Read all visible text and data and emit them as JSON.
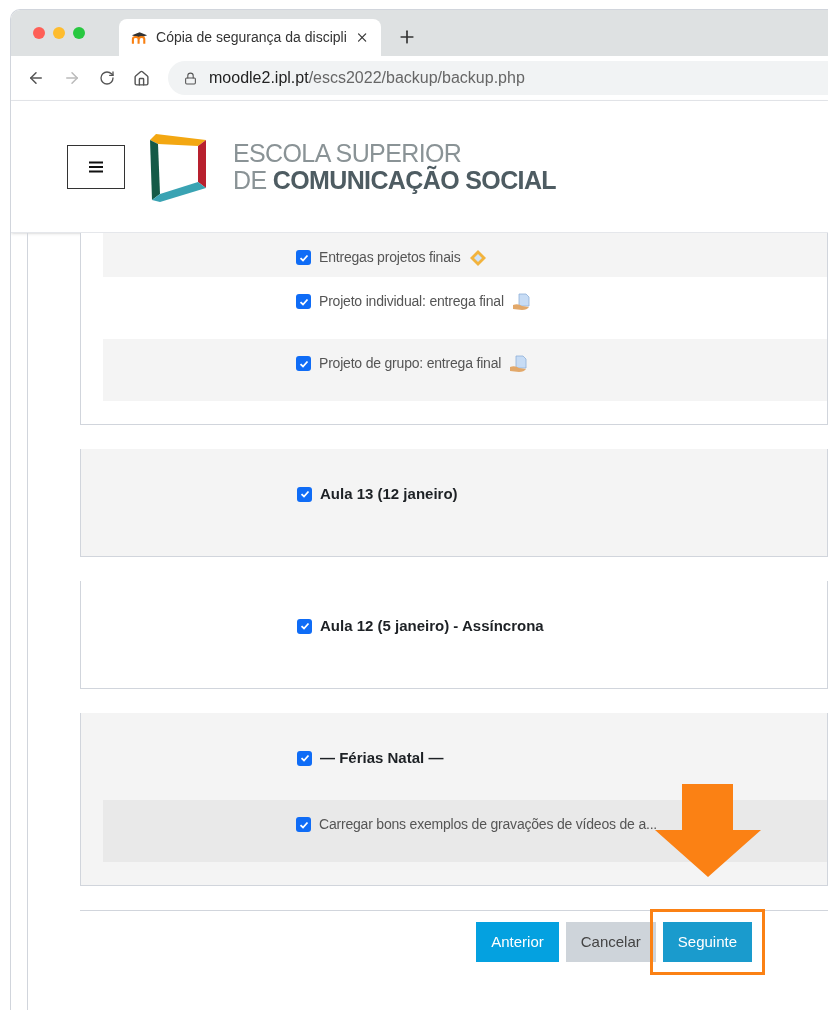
{
  "tab": {
    "title": "Cópia de segurança da discipli",
    "selected": true
  },
  "address": {
    "host": "moodle2.ipl.pt",
    "path": "/escs2022/backup/backup.php"
  },
  "logo": {
    "line1": "ESCOLA SUPERIOR",
    "line2_light": "DE",
    "line2_bold": "COMUNICAÇÃO SOCIAL"
  },
  "sections": [
    {
      "items": [
        {
          "label": "Entregas projetos finais",
          "checked": true,
          "kind": "workshop"
        },
        {
          "label": "Projeto individual: entrega final",
          "checked": true,
          "kind": "assignment"
        },
        {
          "label": "Projeto de grupo: entrega final",
          "checked": true,
          "kind": "assignment"
        }
      ]
    },
    {
      "title": "Aula 13 (12 janeiro)",
      "checked": true
    },
    {
      "title": "Aula 12 (5 janeiro) - Assíncrona",
      "checked": true
    },
    {
      "title": "— Férias Natal —",
      "checked": true,
      "items": [
        {
          "label": "Carregar bons exemplos de gravações de vídeos de a...",
          "checked": true
        }
      ]
    }
  ],
  "buttons": [
    {
      "label": "Anterior",
      "kind": "primary",
      "highlighted": false
    },
    {
      "label": "Cancelar",
      "kind": "secondary",
      "highlighted": false
    },
    {
      "label": "Seguinte",
      "kind": "primary",
      "highlighted": true
    }
  ]
}
